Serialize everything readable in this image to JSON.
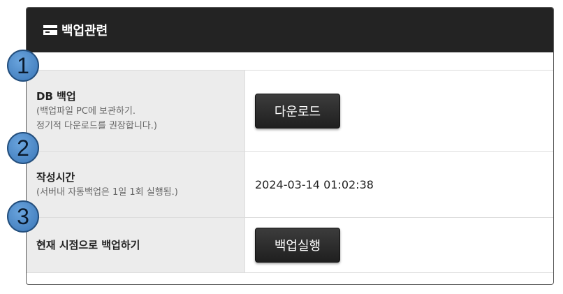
{
  "panel": {
    "title": "백업관련",
    "icon": "card-icon"
  },
  "rows": [
    {
      "title": "DB 백업",
      "sub1": "(백업파일 PC에 보관하기.",
      "sub2": "정기적 다운로드를 권장합니다.)",
      "button": "다운로드"
    },
    {
      "title": "작성시간",
      "sub1": "(서버내 자동백업은 1일 1회 실행됨.)",
      "value": "2024-03-14 01:02:38"
    },
    {
      "title": "현재 시점으로 백업하기",
      "button": "백업실행"
    }
  ],
  "badges": [
    "1",
    "2",
    "3"
  ],
  "colors": {
    "header_bg": "#232323",
    "label_bg": "#ececec",
    "badge": "#4a86c8"
  }
}
